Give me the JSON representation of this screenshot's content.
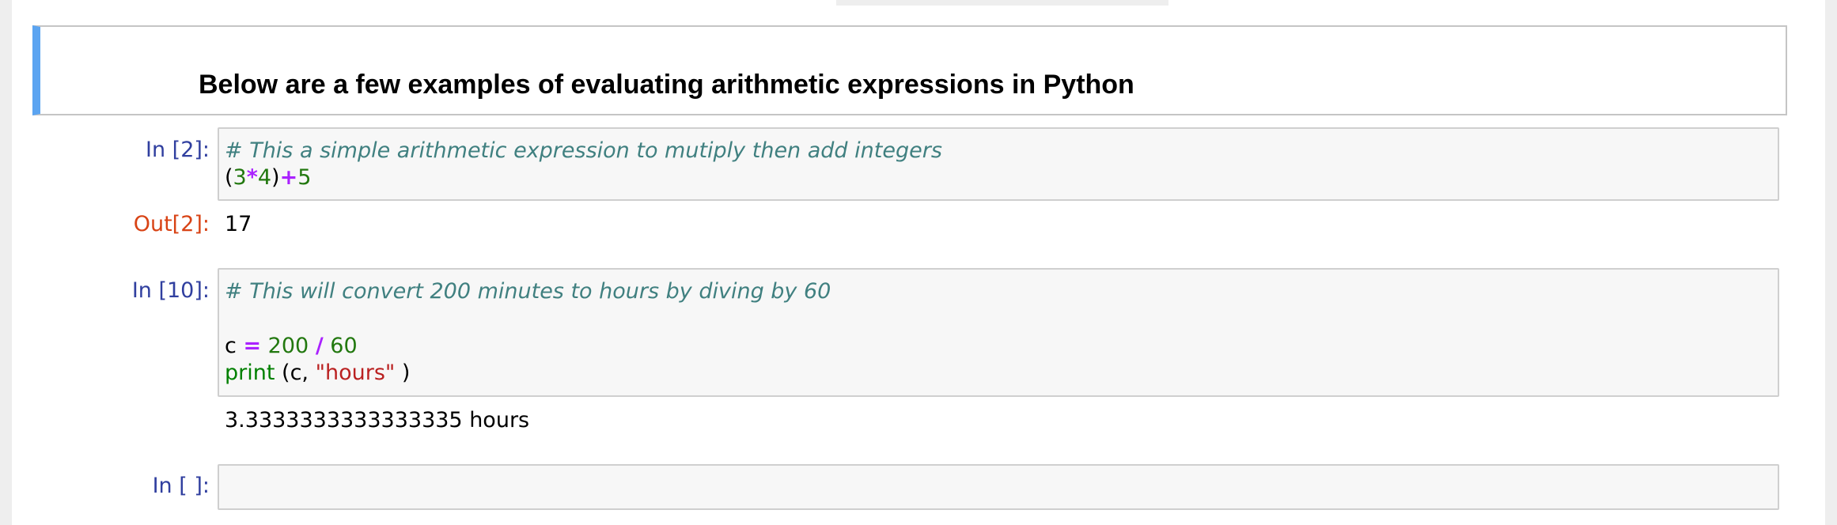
{
  "markdown": {
    "heading": "Below are a few examples of evaluating arithmetic expressions in Python"
  },
  "cell1": {
    "prompt": "In [2]:",
    "comment": "# This a simple arithmetic expression to mutiply then add integers",
    "code": {
      "open_paren": "(",
      "num_a": "3",
      "op_mul": "*",
      "num_b": "4",
      "close_paren": ")",
      "op_add": "+",
      "num_c": "5"
    },
    "out_prompt": "Out[2]:",
    "output": "17"
  },
  "cell2": {
    "prompt": "In [10]:",
    "comment": "# This will convert 200 minutes to hours by diving by 60",
    "line2": {
      "var": "c",
      "op_eq": "=",
      "num_a": "200",
      "op_div": "/",
      "num_b": "60"
    },
    "line3": {
      "func": "print",
      "args_open": " (c, ",
      "string": "\"hours\"",
      "args_close": " )"
    },
    "output": "3.3333333333333335 hours"
  },
  "cell3": {
    "prompt": "In [ ]:",
    "value": ""
  },
  "colors": {
    "selected_cell_bar": "#5ba4f1",
    "in_prompt": "#303f9f",
    "out_prompt": "#d84315",
    "comment": "#408080",
    "number": "#22780f",
    "operator": "#aa22ff",
    "string": "#ba2121"
  }
}
